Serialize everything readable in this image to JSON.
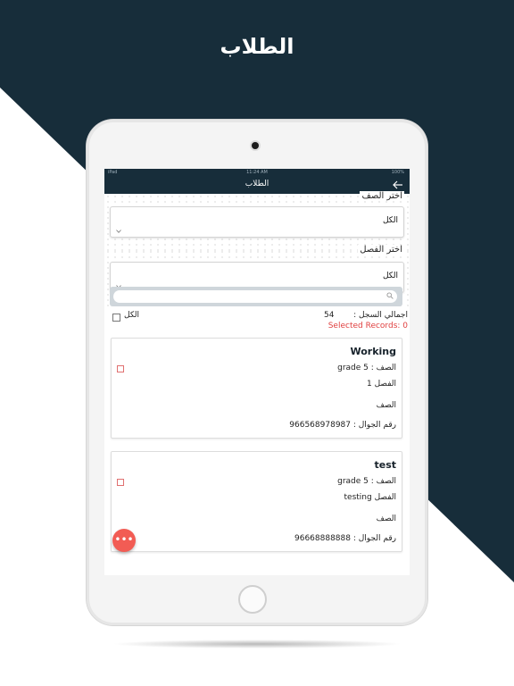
{
  "hero": {
    "title": "الطلاب"
  },
  "statusbar": {
    "time": "11:24 AM",
    "battery": "100%",
    "carrier": "iPad"
  },
  "navbar": {
    "title": "الطلاب"
  },
  "filters": {
    "class_label": "اختر الصف",
    "class_value": "الكل",
    "section_label": "اختر الفصل",
    "section_value": "الكل"
  },
  "search": {
    "placeholder": ""
  },
  "summary": {
    "all_label": "الكل",
    "total_label": "اجمالي السجل :",
    "total_count": "54",
    "selected_records": "Selected Records: 0"
  },
  "students": [
    {
      "name": "Working",
      "grade_row": "الصف :  grade 5",
      "section_row": "الفصل 1",
      "class_row": "الصف",
      "phone_row": "رقم الجوال : 966568978987"
    },
    {
      "name": "test",
      "grade_row": "الصف :  grade 5",
      "section_row": "الفصل testing",
      "class_row": "الصف",
      "phone_row": "رقم الجوال : 96668888888"
    }
  ],
  "colors": {
    "navy": "#172d3a",
    "fab": "#f25c54",
    "selected_text": "#e04040"
  },
  "icons": {
    "back": "arrow-right-icon",
    "search": "search-icon",
    "chevron": "chevron-down-icon",
    "more": "more-dots-icon"
  }
}
